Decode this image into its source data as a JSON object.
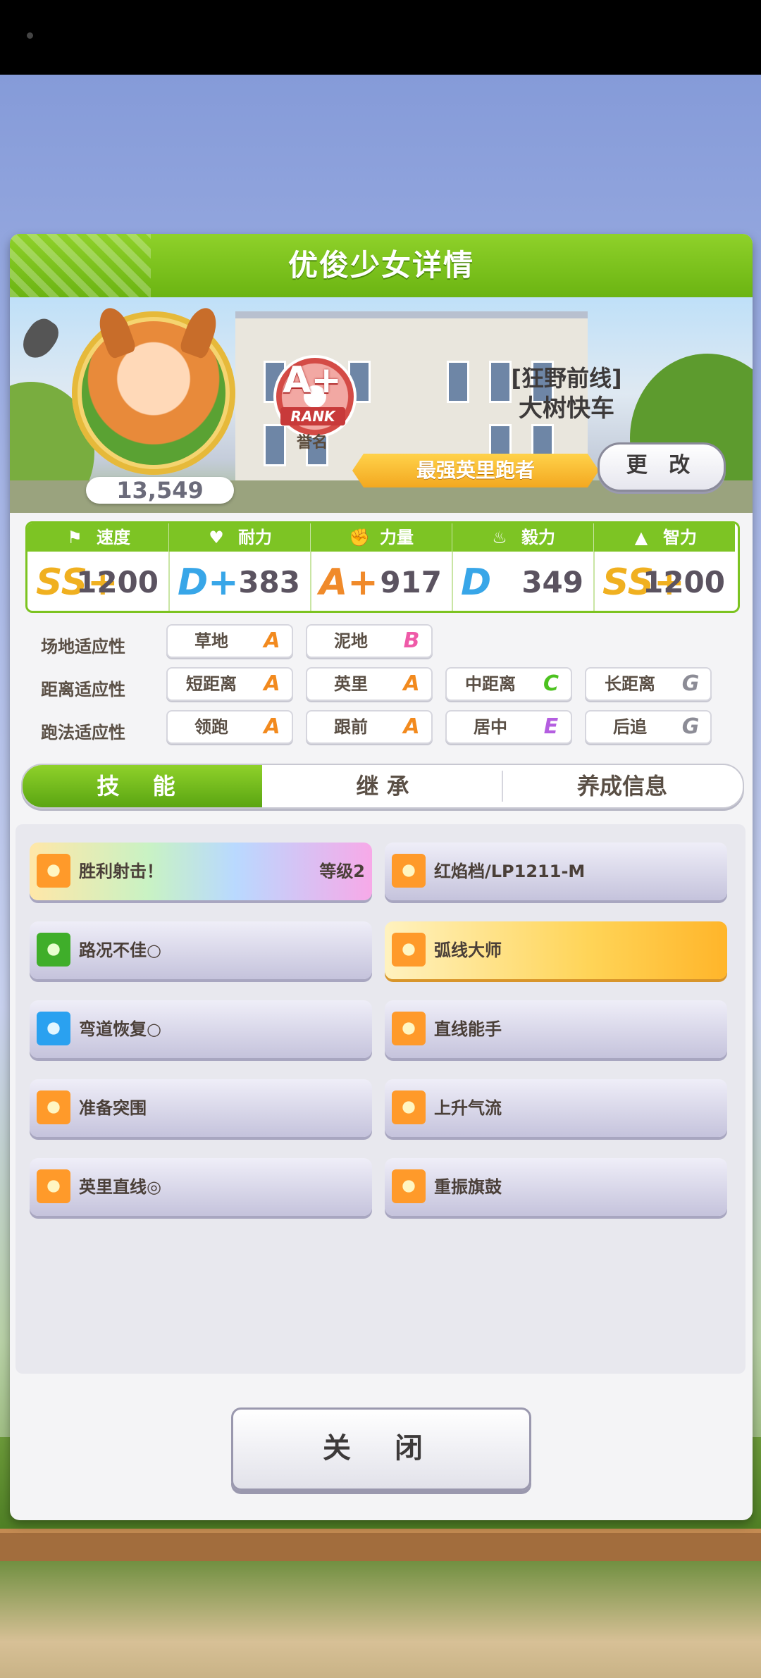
{
  "dialog": {
    "title": "优俊少女详情",
    "fans": "13,549",
    "rank": {
      "grade": "A+",
      "label": "RANK",
      "sub": "誉名"
    },
    "trainee": {
      "epithet": "[狂野前线]",
      "name": "大树快车"
    },
    "title_ribbon": "最强英里跑者",
    "change_label": "更 改"
  },
  "stats": [
    {
      "label": "速度",
      "icon": "shoe-icon",
      "grade": "SS+",
      "value": "1200",
      "grade_color": "#f0b020"
    },
    {
      "label": "耐力",
      "icon": "heart-icon",
      "grade": "D+",
      "value": "383",
      "grade_color": "#38a6e8"
    },
    {
      "label": "力量",
      "icon": "arm-icon",
      "grade": "A+",
      "value": "917",
      "grade_color": "#f08a2a"
    },
    {
      "label": "毅力",
      "icon": "flame-icon",
      "grade": "D",
      "value": "349",
      "grade_color": "#38a6e8"
    },
    {
      "label": "智力",
      "icon": "graduation-cap-icon",
      "grade": "SS+",
      "value": "1200",
      "grade_color": "#f0b020"
    }
  ],
  "aptitudes": {
    "track": {
      "label": "场地适应性",
      "items": [
        {
          "name": "草地",
          "grade": "A"
        },
        {
          "name": "泥地",
          "grade": "B"
        }
      ]
    },
    "distance": {
      "label": "距离适应性",
      "items": [
        {
          "name": "短距离",
          "grade": "A"
        },
        {
          "name": "英里",
          "grade": "A"
        },
        {
          "name": "中距离",
          "grade": "C"
        },
        {
          "name": "长距离",
          "grade": "G"
        }
      ]
    },
    "style": {
      "label": "跑法适应性",
      "items": [
        {
          "name": "领跑",
          "grade": "A"
        },
        {
          "name": "跟前",
          "grade": "A"
        },
        {
          "name": "居中",
          "grade": "E"
        },
        {
          "name": "后追",
          "grade": "G"
        }
      ]
    },
    "grade_colors": {
      "A": "#f28a1e",
      "B": "#ef5aa8",
      "C": "#4cc21f",
      "E": "#b45ee0",
      "G": "#8c8c96"
    }
  },
  "tabs": [
    {
      "label": "技 能"
    },
    {
      "label": "继 承"
    },
    {
      "label": "养成信息"
    }
  ],
  "skills": [
    {
      "name": "胜利射击！",
      "level": "等级2",
      "icon": "orange"
    },
    {
      "name": "红焰档/LP1211-M",
      "level": "",
      "icon": "orange"
    },
    {
      "name": "路况不佳○",
      "level": "",
      "icon": "green"
    },
    {
      "name": "弧线大师",
      "level": "",
      "icon": "orange"
    },
    {
      "name": "弯道恢复○",
      "level": "",
      "icon": "blue"
    },
    {
      "name": "直线能手",
      "level": "",
      "icon": "orange"
    },
    {
      "name": "准备突围",
      "level": "",
      "icon": "orange"
    },
    {
      "name": "上升气流",
      "level": "",
      "icon": "orange"
    },
    {
      "name": "英里直线◎",
      "level": "",
      "icon": "orange"
    },
    {
      "name": "重振旗鼓",
      "level": "",
      "icon": "orange"
    }
  ],
  "close_label": "关 闭"
}
